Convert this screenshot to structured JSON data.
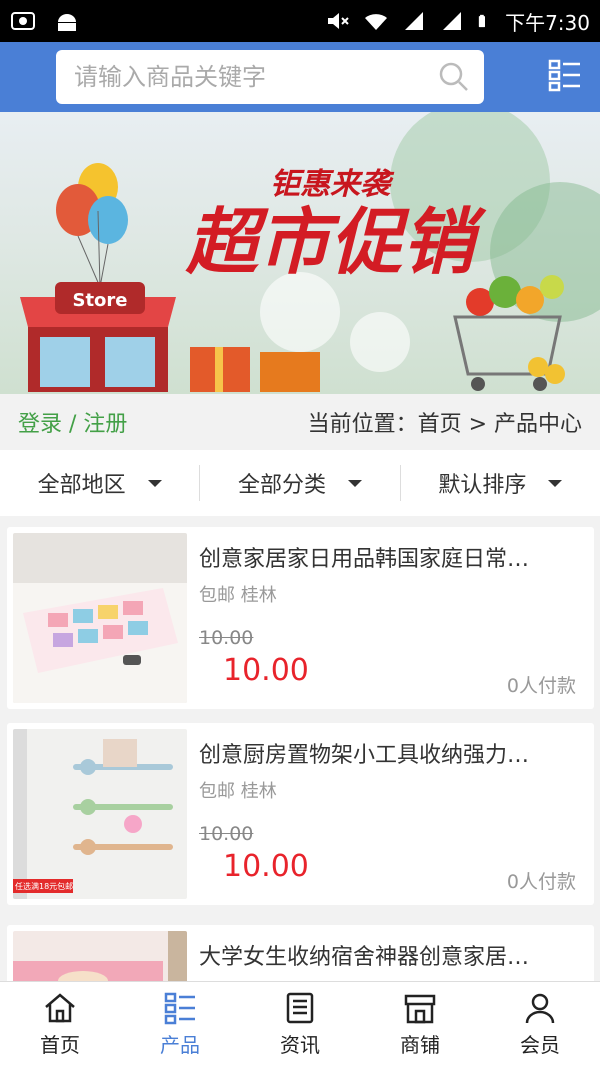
{
  "status_bar": {
    "time": "下午7:30"
  },
  "search": {
    "placeholder": "请输入商品关键字"
  },
  "banner": {
    "subtitle": "钜惠来袭",
    "title": "超市促销",
    "store_sign": "Store"
  },
  "location_bar": {
    "login": "登录 / 注册",
    "breadcrumb": "当前位置：首页 > 产品中心"
  },
  "filters": [
    {
      "label": "全部地区"
    },
    {
      "label": "全部分类"
    },
    {
      "label": "默认排序"
    }
  ],
  "products": [
    {
      "title": "创意家居家日用品韩国家庭日常…",
      "meta": "包邮 桂林",
      "old_price": "10.00",
      "price": "10.00",
      "sold": "0人付款"
    },
    {
      "title": "创意厨房置物架小工具收纳强力…",
      "meta": "包邮 桂林",
      "old_price": "10.00",
      "price": "10.00",
      "sold": "0人付款",
      "promo": "任选满18元包邮"
    },
    {
      "title": "大学女生收纳宿舍神器创意家居…",
      "meta": "",
      "old_price": "",
      "price": "",
      "sold": ""
    }
  ],
  "bottom_nav": [
    {
      "label": "首页",
      "icon": "home-icon"
    },
    {
      "label": "产品",
      "icon": "list-icon",
      "active": true
    },
    {
      "label": "资讯",
      "icon": "news-icon"
    },
    {
      "label": "商铺",
      "icon": "shop-icon"
    },
    {
      "label": "会员",
      "icon": "user-icon"
    }
  ],
  "colors": {
    "header": "#4a7fd6",
    "price": "#e8232b",
    "login": "#43a047"
  }
}
